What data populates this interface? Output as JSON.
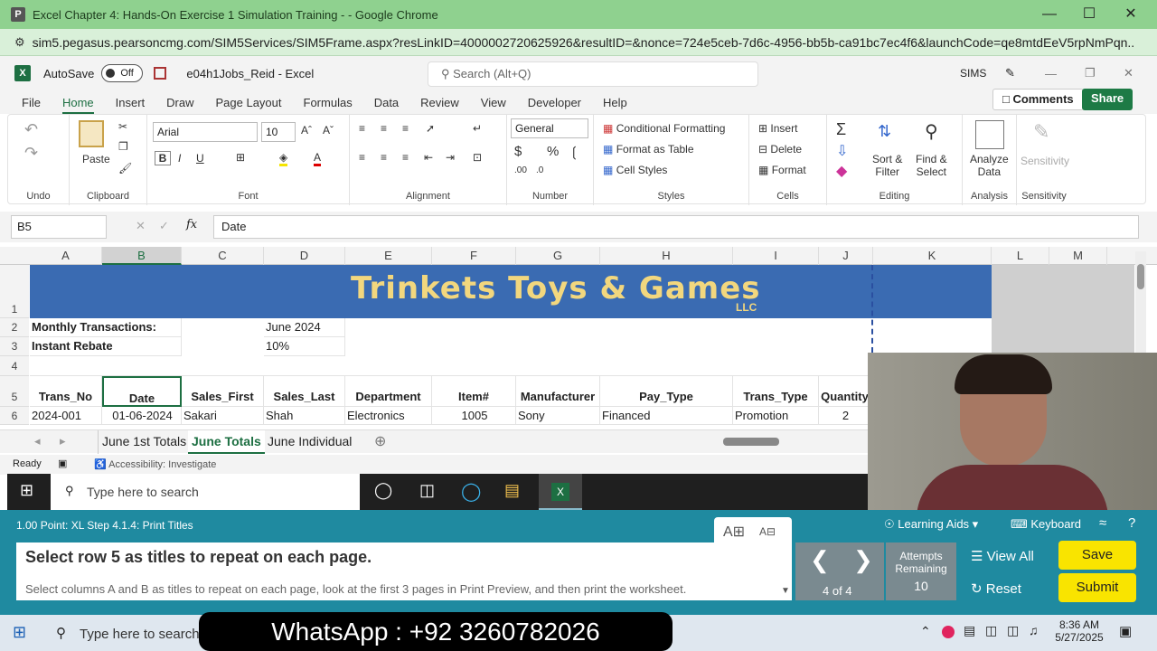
{
  "browser": {
    "title": "Excel Chapter 4: Hands-On Exercise 1 Simulation Training - - Google Chrome",
    "url": "sim5.pegasus.pearsoncmg.com/SIM5Services/SIM5Frame.aspx?resLinkID=4000002720625926&resultID=&nonce=724e5ceb-7d6c-4956-bb5b-ca91bc7ec4f6&launchCode=qe8mtdEeV5rpNmPqn...",
    "icon": "P"
  },
  "excel": {
    "autosave": "AutoSave",
    "toggle": "Off",
    "filename": "e04h1Jobs_Reid  -  Excel",
    "search": "Search (Alt+Q)",
    "user": "SIMS",
    "logo": "X"
  },
  "menu": [
    "File",
    "Home",
    "Insert",
    "Draw",
    "Page Layout",
    "Formulas",
    "Data",
    "Review",
    "View",
    "Developer",
    "Help"
  ],
  "comments": "Comments",
  "share": "Share",
  "ribbon": {
    "undo": "Undo",
    "clipboard": "Clipboard",
    "paste": "Paste",
    "font": "Font",
    "font_name": "Arial",
    "font_size": "10",
    "alignment": "Alignment",
    "number_format": "General",
    "number": "Number",
    "cond_format": "Conditional Formatting",
    "format_table": "Format as Table",
    "cell_styles": "Cell Styles",
    "styles": "Styles",
    "insert": "Insert",
    "delete": "Delete",
    "format": "Format",
    "cells": "Cells",
    "sort_filter1": "Sort &",
    "sort_filter2": "Filter",
    "find_select1": "Find &",
    "find_select2": "Select",
    "editing": "Editing",
    "analyze1": "Analyze",
    "analyze2": "Data",
    "analysis": "Analysis",
    "sensitivity": "Sensitivity",
    "bold": "B",
    "italic": "I",
    "underline": "U",
    "fx": "fx"
  },
  "formula": {
    "namebox": "B5",
    "value": "Date"
  },
  "columns": [
    "A",
    "B",
    "C",
    "D",
    "E",
    "F",
    "G",
    "H",
    "I",
    "J",
    "K",
    "L",
    "M"
  ],
  "rows": [
    "1",
    "2",
    "3",
    "4",
    "5",
    "6"
  ],
  "sheet": {
    "title": "Trinkets Toys & Games",
    "llc": "LLC",
    "r2a": "Monthly Transactions:",
    "r2d": "June 2024",
    "r3a": "Instant Rebate",
    "r3d": "10%",
    "headers": [
      "Trans_No",
      "Date",
      "Sales_First",
      "Sales_Last",
      "Department",
      "Item#",
      "Manufacturer",
      "Pay_Type",
      "Trans_Type",
      "Quantity"
    ],
    "row6": [
      "2024-001",
      "01-06-2024",
      "Sakari",
      "Shah",
      "Electronics",
      "1005",
      "Sony",
      "Financed",
      "Promotion",
      "2"
    ]
  },
  "tabs": [
    "June 1st Totals",
    "June Totals",
    "June Individual"
  ],
  "status": {
    "ready": "Ready",
    "accessibility": "Accessibility: Investigate"
  },
  "taskbar1": {
    "search": "Type here to search"
  },
  "instructions": {
    "step": "1.00 Point: XL Step 4.1.4: Print Titles",
    "main": "Select row 5 as titles to repeat on each page.",
    "detail": "Select columns A and B as titles to repeat on each page, look at the first 3 pages in Print Preview, and then print the worksheet.",
    "learning": "Learning Aids",
    "keyboard": "Keyboard",
    "page": "4 of 4",
    "attempts1": "Attempts",
    "attempts2": "Remaining",
    "attempts_n": "10",
    "view_all": "View All",
    "reset": "Reset",
    "save": "Save",
    "submit": "Submit"
  },
  "taskbar2": {
    "search": "Type here to search",
    "time": "8:36 AM",
    "date": "5/27/2025"
  },
  "watermark": "WhatsApp : +92 3260782026"
}
